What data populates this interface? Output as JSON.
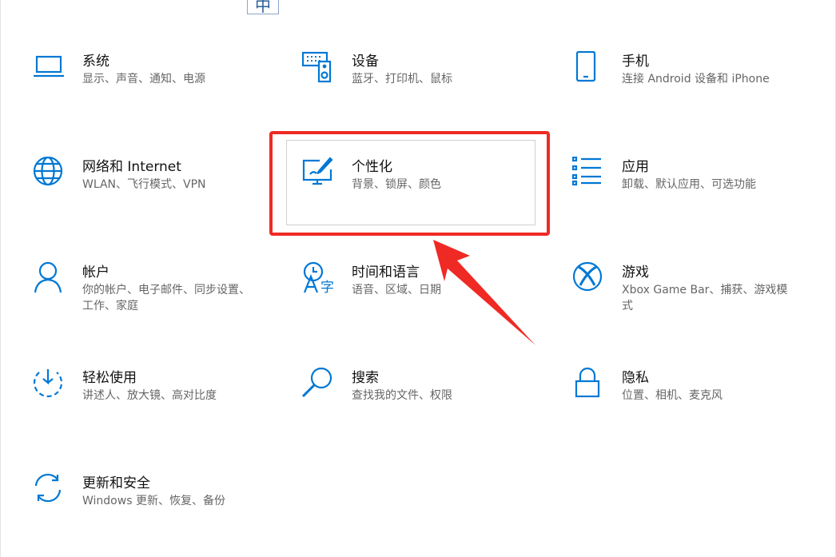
{
  "ime": {
    "label": "中"
  },
  "tiles": [
    {
      "title": "系统",
      "desc": "显示、声音、通知、电源"
    },
    {
      "title": "设备",
      "desc": "蓝牙、打印机、鼠标"
    },
    {
      "title": "手机",
      "desc": "连接 Android 设备和 iPhone"
    },
    {
      "title": "网络和 Internet",
      "desc": "WLAN、飞行模式、VPN"
    },
    {
      "title": "个性化",
      "desc": "背景、锁屏、颜色"
    },
    {
      "title": "应用",
      "desc": "卸载、默认应用、可选功能"
    },
    {
      "title": "帐户",
      "desc": "你的帐户、电子邮件、同步设置、工作、家庭"
    },
    {
      "title": "时间和语言",
      "desc": "语音、区域、日期"
    },
    {
      "title": "游戏",
      "desc": "Xbox Game Bar、捕获、游戏模式"
    },
    {
      "title": "轻松使用",
      "desc": "讲述人、放大镜、高对比度"
    },
    {
      "title": "搜索",
      "desc": "查找我的文件、权限"
    },
    {
      "title": "隐私",
      "desc": "位置、相机、麦克风"
    },
    {
      "title": "更新和安全",
      "desc": "Windows 更新、恢复、备份"
    }
  ],
  "icons": [
    "laptop-icon",
    "keyboard-speaker-icon",
    "phone-icon",
    "globe-icon",
    "paint-monitor-icon",
    "apps-list-icon",
    "person-icon",
    "language-icon",
    "xbox-icon",
    "ease-of-access-icon",
    "search-icon",
    "lock-icon",
    "sync-icon"
  ],
  "colors": {
    "accent": "#0078d4",
    "annotation": "#ef2a24"
  }
}
